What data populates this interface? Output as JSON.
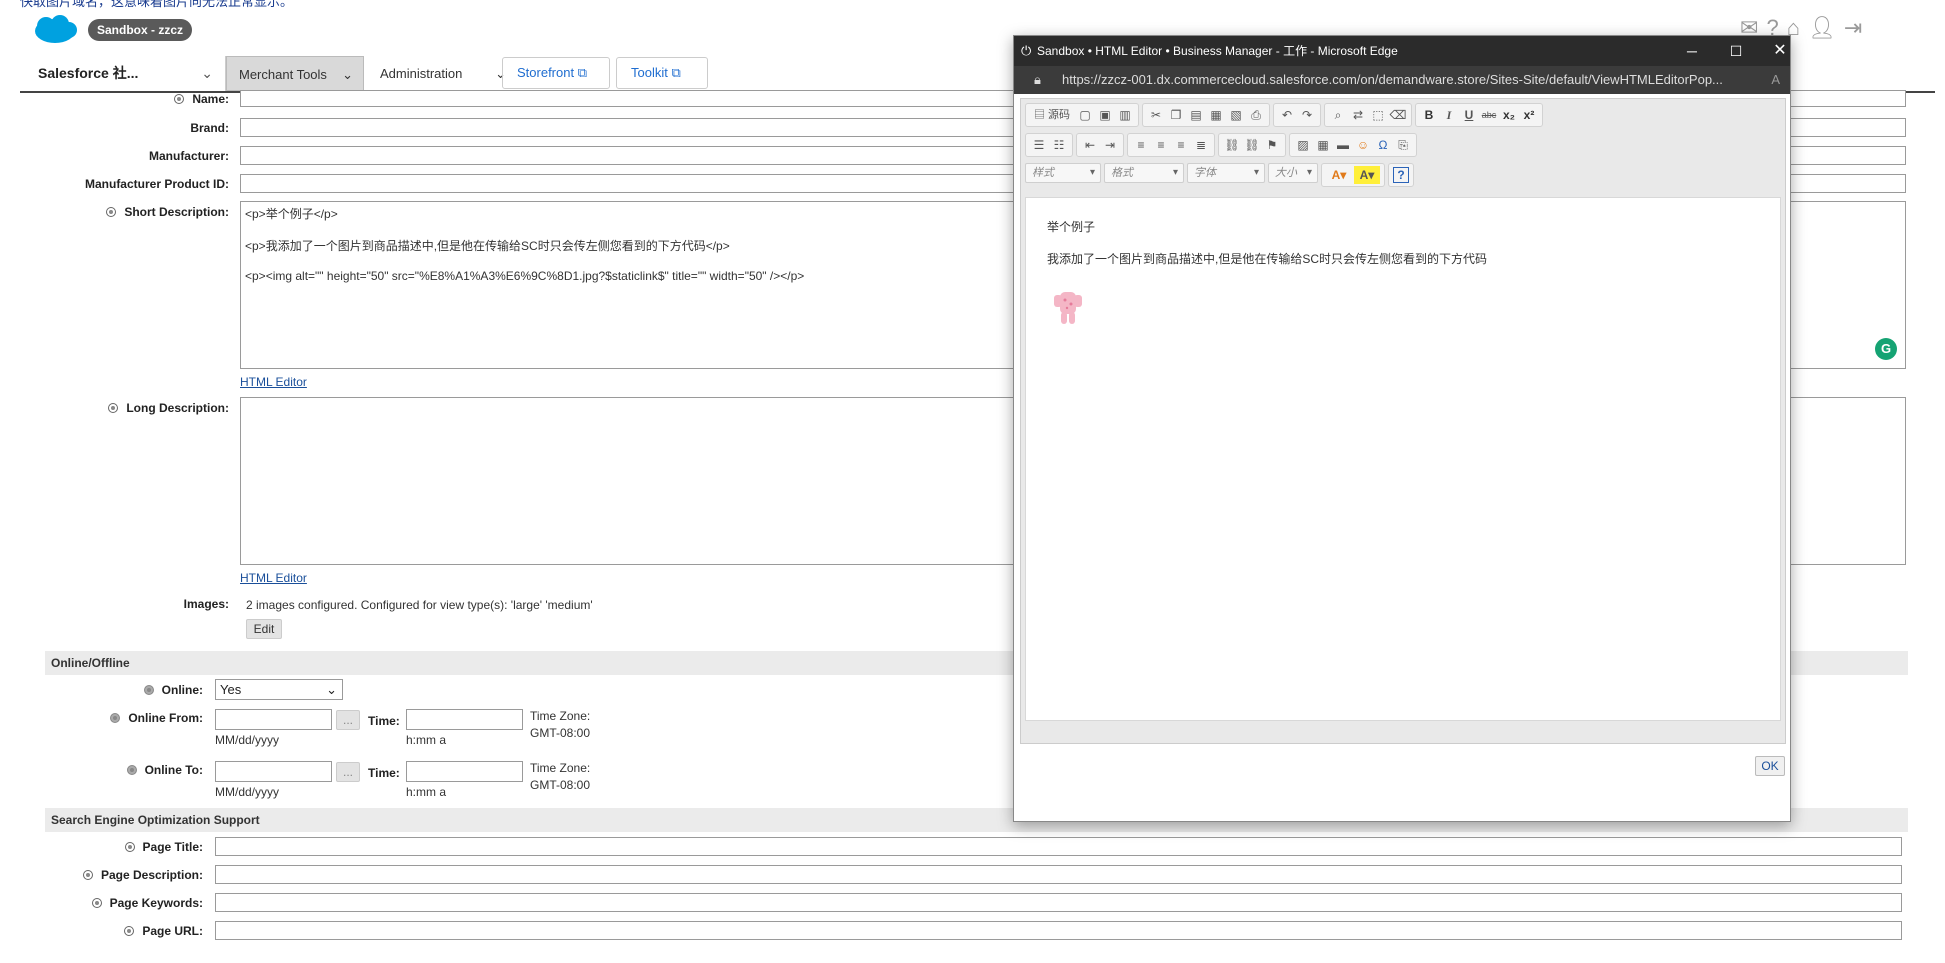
{
  "top_banner": "快取图片域名，这意味着图片向无法正常显示。",
  "header": {
    "sandbox_label": "Sandbox - zzcz",
    "icons": [
      "notifications-icon",
      "help-icon",
      "home-icon",
      "user-icon",
      "logout-icon"
    ]
  },
  "nav": {
    "app_label": "Salesforce 社...",
    "merchant_tools": "Merchant Tools",
    "administration": "Administration",
    "storefront": "Storefront",
    "toolkit": "Toolkit"
  },
  "form": {
    "name_label": "Name:",
    "brand_label": "Brand:",
    "manufacturer_label": "Manufacturer:",
    "manufacturer_pid_label": "Manufacturer Product ID:",
    "short_desc_label": "Short Description:",
    "short_desc_lines": [
      "<p>举个例子</p>",
      "<p>我添加了一个图片到商品描述中,但是他在传输给SC时只会传左侧您看到的下方代码</p>",
      "<p><img alt=\"\" height=\"50\" src=\"%E8%A1%A3%E6%9C%8D1.jpg?$staticlink$\" title=\"\" width=\"50\" /></p>"
    ],
    "html_editor_link": "HTML Editor",
    "long_desc_label": "Long Description:",
    "images_label": "Images:",
    "images_text": "2 images configured. Configured for view type(s): 'large' 'medium'",
    "edit_button": "Edit"
  },
  "online_section": {
    "title": "Online/Offline",
    "online_label": "Online:",
    "online_value": "Yes",
    "online_from_label": "Online From:",
    "online_to_label": "Online To:",
    "date_format": "MM/dd/yyyy",
    "time_label": "Time:",
    "time_format": "h:mm a",
    "tz_label": "Time Zone:",
    "tz_value": "GMT-08:00",
    "picker_btn": "..."
  },
  "seo_section": {
    "title": "Search Engine Optimization Support",
    "page_title_label": "Page Title:",
    "page_desc_label": "Page Description:",
    "page_keywords_label": "Page Keywords:",
    "page_url_label": "Page URL:"
  },
  "popup": {
    "title": "Sandbox • HTML Editor • Business Manager - 工作 - Microsoft Edge",
    "url": "https://zzcz-001.dx.commercecloud.salesforce.com/on/demandware.store/Sites-Site/default/ViewHTMLEditorPop...",
    "toolbar": {
      "source": "源码",
      "bold": "B",
      "italic": "I",
      "underline": "U",
      "strike": "abc",
      "subscript": "x₂",
      "superscript": "x²",
      "style_combo": "样式",
      "format_combo": "格式",
      "font_combo": "字体",
      "size_combo": "大小"
    },
    "content_p1": "举个例子",
    "content_p2": "我添加了一个图片到商品描述中,但是他在传输给SC时只会传左侧您看到的下方代码",
    "ok_button": "OK"
  },
  "grammarly_icon": "G"
}
